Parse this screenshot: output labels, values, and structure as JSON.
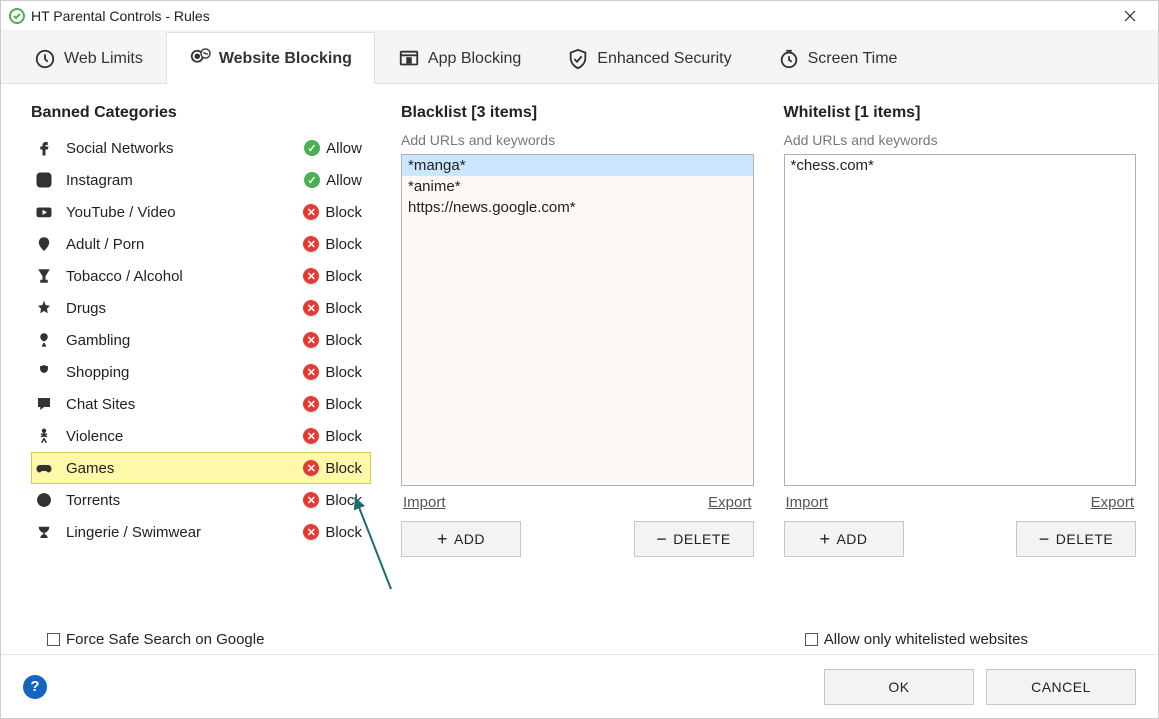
{
  "window": {
    "title": "HT Parental Controls - Rules"
  },
  "tabs": [
    {
      "label": "Web Limits",
      "active": false
    },
    {
      "label": "Website Blocking",
      "active": true
    },
    {
      "label": "App Blocking",
      "active": false
    },
    {
      "label": "Enhanced Security",
      "active": false
    },
    {
      "label": "Screen Time",
      "active": false
    }
  ],
  "banned": {
    "heading": "Banned Categories",
    "categories": [
      {
        "icon": "facebook",
        "label": "Social Networks",
        "status": "Allow"
      },
      {
        "icon": "instagram",
        "label": "Instagram",
        "status": "Allow"
      },
      {
        "icon": "youtube",
        "label": "YouTube / Video",
        "status": "Block"
      },
      {
        "icon": "adult",
        "label": "Adult / Porn",
        "status": "Block"
      },
      {
        "icon": "alcohol",
        "label": "Tobacco / Alcohol",
        "status": "Block"
      },
      {
        "icon": "drugs",
        "label": "Drugs",
        "status": "Block"
      },
      {
        "icon": "gambling",
        "label": "Gambling",
        "status": "Block"
      },
      {
        "icon": "shopping",
        "label": "Shopping",
        "status": "Block"
      },
      {
        "icon": "chat",
        "label": "Chat Sites",
        "status": "Block"
      },
      {
        "icon": "violence",
        "label": "Violence",
        "status": "Block"
      },
      {
        "icon": "games",
        "label": "Games",
        "status": "Block",
        "highlight": true
      },
      {
        "icon": "torrents",
        "label": "Torrents",
        "status": "Block"
      },
      {
        "icon": "lingerie",
        "label": "Lingerie / Swimwear",
        "status": "Block"
      }
    ]
  },
  "blacklist": {
    "heading": "Blacklist [3 items]",
    "hint": "Add URLs and keywords",
    "items": [
      "*manga*",
      "*anime*",
      "https://news.google.com*"
    ],
    "selected_index": 0,
    "import": "Import",
    "export": "Export",
    "add": "ADD",
    "delete": "DELETE"
  },
  "whitelist": {
    "heading": "Whitelist [1 items]",
    "hint": "Add URLs and keywords",
    "items": [
      "*chess.com*"
    ],
    "selected_index": -1,
    "import": "Import",
    "export": "Export",
    "add": "ADD",
    "delete": "DELETE"
  },
  "options": {
    "force_safe_search": {
      "label": "Force Safe Search on Google",
      "checked": false
    },
    "allow_only_whitelist": {
      "label": "Allow only whitelisted websites",
      "checked": false
    }
  },
  "footer": {
    "ok": "OK",
    "cancel": "CANCEL"
  },
  "colors": {
    "allow": "#4caf50",
    "block": "#e53935",
    "highlight": "#fdf9a8"
  }
}
